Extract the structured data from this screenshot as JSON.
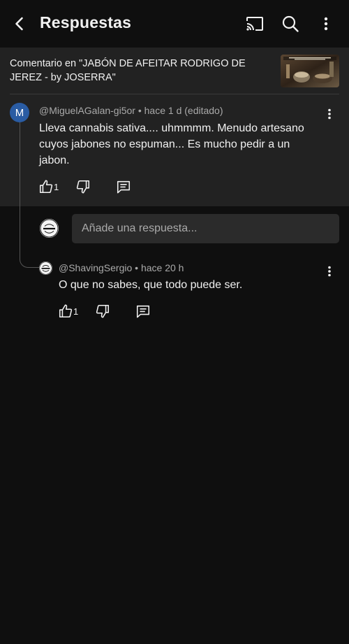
{
  "header": {
    "title": "Respuestas",
    "icons": [
      "back-arrow-icon",
      "cast-icon",
      "search-icon",
      "more-vert-icon"
    ]
  },
  "context": {
    "text": "Comentario en \"JABÓN DE AFEITAR RODRIGO DE JEREZ - by JOSERRA\"",
    "thumbnail_caption": "JABÓN DE AFEITAR RODRIGO DE JEREZ"
  },
  "comment": {
    "avatar_letter": "M",
    "avatar_color": "#2a5ca3",
    "author": "@MiguelAGalan-gi5or",
    "time": "hace 1 d (editado)",
    "text": "Lleva cannabis sativa.... uhmmmm. Menudo artesano cuyos jabones no espuman... Es mucho pedir a un jabon.",
    "likes": "1"
  },
  "reply_box": {
    "placeholder": "Añade una respuesta..."
  },
  "reply": {
    "author": "@ShavingSergio",
    "time": "hace 20 h",
    "text": "O que no sabes, que todo puede ser.",
    "likes": "1"
  },
  "colors": {
    "background": "#0f0f0f",
    "panel": "#222222",
    "text": "#f1f1f1",
    "secondary_text": "#aaaaaa"
  }
}
